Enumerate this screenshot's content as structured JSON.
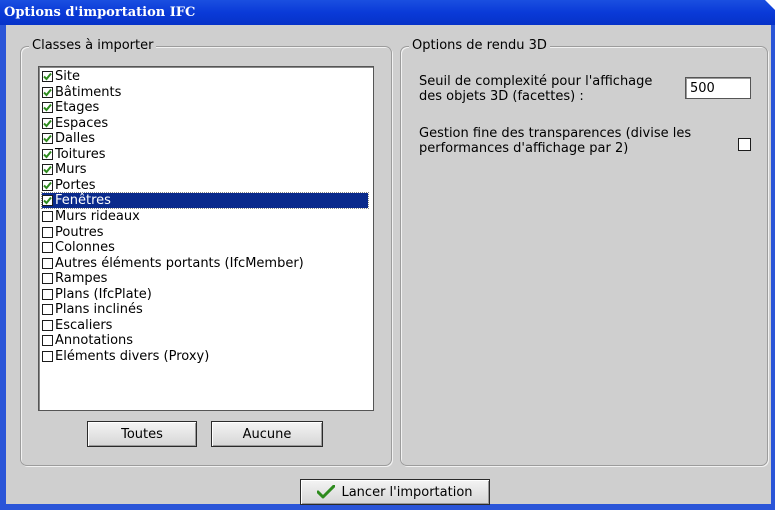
{
  "window": {
    "title": "Options d'importation IFC"
  },
  "classes": {
    "title": "Classes à importer",
    "items": [
      {
        "label": "Site",
        "checked": true
      },
      {
        "label": "Bâtiments",
        "checked": true
      },
      {
        "label": "Etages",
        "checked": true
      },
      {
        "label": "Espaces",
        "checked": true
      },
      {
        "label": "Dalles",
        "checked": true
      },
      {
        "label": "Toitures",
        "checked": true
      },
      {
        "label": "Murs",
        "checked": true
      },
      {
        "label": "Portes",
        "checked": true
      },
      {
        "label": "Fenêtres",
        "checked": true,
        "selected": true
      },
      {
        "label": "Murs rideaux",
        "checked": false
      },
      {
        "label": "Poutres",
        "checked": false
      },
      {
        "label": "Colonnes",
        "checked": false
      },
      {
        "label": "Autres éléments portants (IfcMember)",
        "checked": false
      },
      {
        "label": "Rampes",
        "checked": false
      },
      {
        "label": "Plans (IfcPlate)",
        "checked": false
      },
      {
        "label": "Plans inclinés",
        "checked": false
      },
      {
        "label": "Escaliers",
        "checked": false
      },
      {
        "label": "Annotations",
        "checked": false
      },
      {
        "label": "Eléments divers (Proxy)",
        "checked": false
      }
    ],
    "select_all_label": "Toutes",
    "select_none_label": "Aucune"
  },
  "render": {
    "title": "Options de rendu 3D",
    "threshold_label": "Seuil de complexité pour l'affichage des objets 3D (facettes) :",
    "threshold_value": "500",
    "transparency_label": "Gestion fine des transparences (divise les performances d'affichage par 2)",
    "transparency_checked": false
  },
  "footer": {
    "launch_label": "Lancer l'importation",
    "launch_icon": "checkmark-icon"
  },
  "colors": {
    "titlebar": "#0a3ad8",
    "selection": "#0a2a8c",
    "checkmark": "#2e8b1e",
    "dialog_bg": "#cfcfcf"
  }
}
